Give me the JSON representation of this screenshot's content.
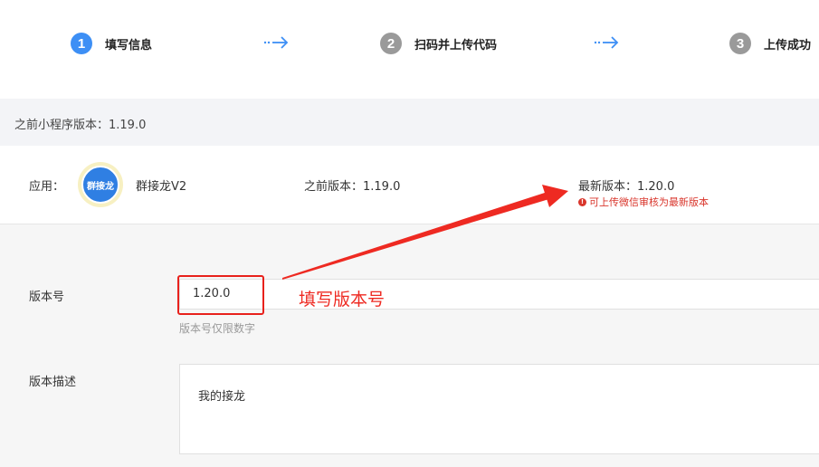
{
  "steps": [
    {
      "num": "1",
      "label": "填写信息",
      "state": "active"
    },
    {
      "num": "2",
      "label": "扫码并上传代码",
      "state": "inactive"
    },
    {
      "num": "3",
      "label": "上传成功",
      "state": "inactive"
    }
  ],
  "previous_bar": {
    "text": "之前小程序版本：1.19.0"
  },
  "app": {
    "label": "应用：",
    "avatar_text": "群接龙",
    "name": "群接龙V2",
    "previous_version": "之前版本：1.19.0",
    "latest_version": "最新版本：1.20.0",
    "warning": "可上传微信审核为最新版本"
  },
  "form": {
    "version_label": "版本号",
    "version_value": "1.20.0",
    "version_hint": "版本号仅限数字",
    "annotation": "填写版本号",
    "desc_label": "版本描述",
    "desc_value": "我的接龙"
  },
  "colors": {
    "accent": "#3d8ff5",
    "annotation_red": "#ee2a22",
    "warning_red": "#d9362c"
  }
}
